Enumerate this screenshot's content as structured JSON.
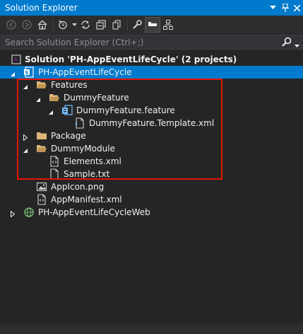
{
  "window": {
    "title": "Solution Explorer"
  },
  "titlebar_icons": [
    "dropdown-icon",
    "pin-icon",
    "close-icon"
  ],
  "toolbar_icons": [
    "back-icon",
    "forward-icon",
    "home-icon",
    "history-icon",
    "sync-icon",
    "collapse-all-icon",
    "show-all-files-icon",
    "properties-icon",
    "preview-icon",
    "class-view-icon"
  ],
  "search": {
    "placeholder": "Search Solution Explorer (Ctrl+;)",
    "value": ""
  },
  "tree": {
    "solution": "Solution 'PH-AppEventLifeCycle' (2 projects)",
    "project": "PH-AppEventLifeCycle",
    "features": "Features",
    "dummy_feature": "DummyFeature",
    "dummy_feature_file": "DummyFeature.feature",
    "template": "DummyFeature.Template.xml",
    "package": "Package",
    "dummy_module": "DummyModule",
    "elements": "Elements.xml",
    "sample": "Sample.txt",
    "app_icon": "AppIcon.png",
    "app_manifest": "AppManifest.xml",
    "web_project": "PH-AppEventLifeCycleWeb"
  },
  "colors": {
    "selection": "#007acc",
    "highlight_box": "#e51400",
    "folder": "#dcb67a"
  }
}
